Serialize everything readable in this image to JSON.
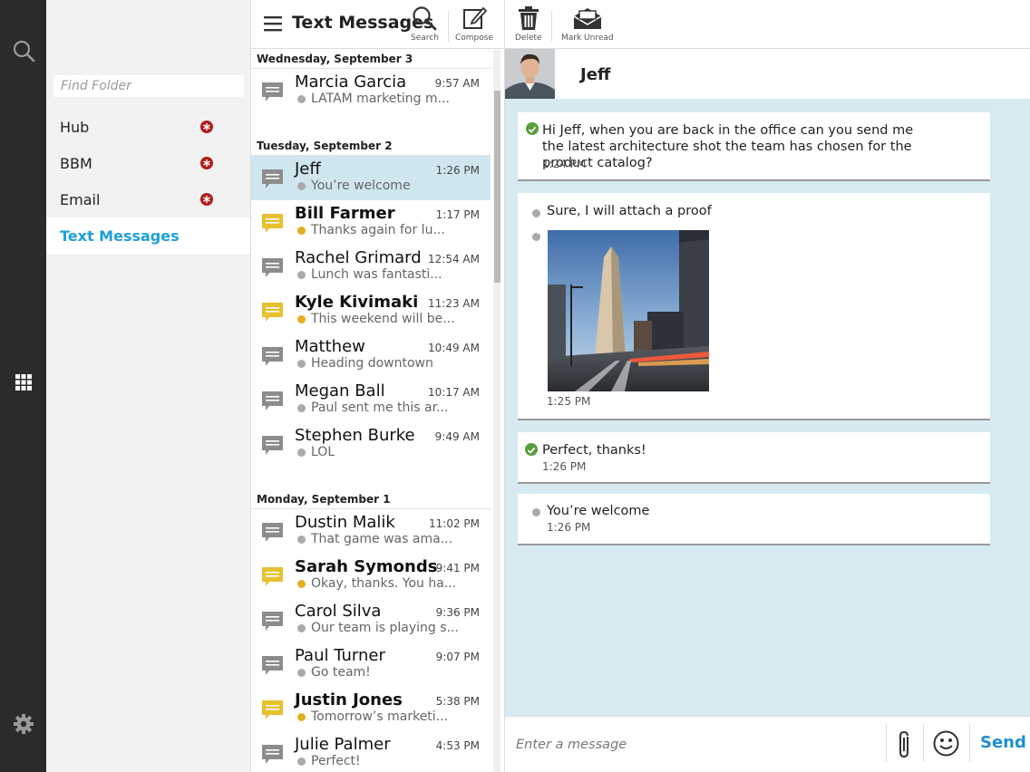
{
  "rail": {
    "icons": [
      "search-icon",
      "apps-grid-icon",
      "gear-icon"
    ]
  },
  "folders": {
    "find_placeholder": "Find Folder",
    "items": [
      {
        "label": "Hub",
        "badge": true
      },
      {
        "label": "BBM",
        "badge": true
      },
      {
        "label": "Email",
        "badge": true
      },
      {
        "label": "Text Messages",
        "badge": false,
        "active": true
      }
    ]
  },
  "list": {
    "title": "Text Messages",
    "toolbar": {
      "search_label": "Search",
      "compose_label": "Compose"
    },
    "groups": [
      {
        "date": "Wednesday, September 3",
        "rows": [
          {
            "name": "Marcia Garcia",
            "time": "9:57 AM",
            "preview": "LATAM marketing m...",
            "unread": false
          }
        ]
      },
      {
        "date": "Tuesday, September 2",
        "rows": [
          {
            "name": "Jeff",
            "time": "1:26 PM",
            "preview": "You’re welcome",
            "unread": false,
            "selected": true
          },
          {
            "name": "Bill Farmer",
            "time": "1:17 PM",
            "preview": "Thanks again for lu...",
            "unread": true
          },
          {
            "name": "Rachel Grimard",
            "time": "12:54 AM",
            "preview": "Lunch was fantasti...",
            "unread": false
          },
          {
            "name": "Kyle Kivimaki",
            "time": "11:23 AM",
            "preview": "This weekend will be...",
            "unread": true
          },
          {
            "name": "Matthew",
            "time": "10:49 AM",
            "preview": "Heading downtown",
            "unread": false
          },
          {
            "name": "Megan Ball",
            "time": "10:17 AM",
            "preview": "Paul sent me this ar...",
            "unread": false
          },
          {
            "name": "Stephen Burke",
            "time": "9:49 AM",
            "preview": "LOL",
            "unread": false
          }
        ]
      },
      {
        "date": "Monday, September 1",
        "rows": [
          {
            "name": "Dustin Malik",
            "time": "11:02 PM",
            "preview": "That game was ama...",
            "unread": false
          },
          {
            "name": "Sarah Symonds",
            "time": "9:41 PM",
            "preview": "Okay, thanks. You ha...",
            "unread": true
          },
          {
            "name": "Carol Silva",
            "time": "9:36 PM",
            "preview": "Our team is playing s...",
            "unread": false
          },
          {
            "name": "Paul Turner",
            "time": "9:07 PM",
            "preview": "Go team!",
            "unread": false
          },
          {
            "name": "Justin Jones",
            "time": "5:38 PM",
            "preview": "Tomorrow’s marketi...",
            "unread": true
          },
          {
            "name": "Julie Palmer",
            "time": "4:53 PM",
            "preview": "Perfect!",
            "unread": false
          }
        ]
      }
    ]
  },
  "conversation": {
    "toolbar": {
      "delete_label": "Delete",
      "mark_unread_label": "Mark Unread"
    },
    "contact": "Jeff",
    "messages": [
      {
        "text": "Hi Jeff, when you are back in the office can you send me the latest architecture shot the team has chosen for the product catalog?",
        "time": "1:24 PM",
        "status": "sent-check"
      },
      {
        "text": "Sure, I will attach a proof",
        "time": "1:25 PM",
        "status": "received-dot",
        "has_image": true
      },
      {
        "text": "Perfect, thanks!",
        "time": "1:26 PM",
        "status": "sent-check"
      },
      {
        "text": "You’re welcome",
        "time": "1:26 PM",
        "status": "received-dot"
      }
    ],
    "compose": {
      "placeholder": "Enter a message",
      "send_label": "Send"
    }
  },
  "colors": {
    "accent": "#1ea0d8",
    "conversation_bg": "#d7eaf2",
    "rail_bg": "#2b2b2b",
    "unread_bubble": "#e8c030",
    "read_bubble": "#8c8c8c",
    "badge_red": "#b01c1c",
    "check_green": "#5a9e3a"
  }
}
